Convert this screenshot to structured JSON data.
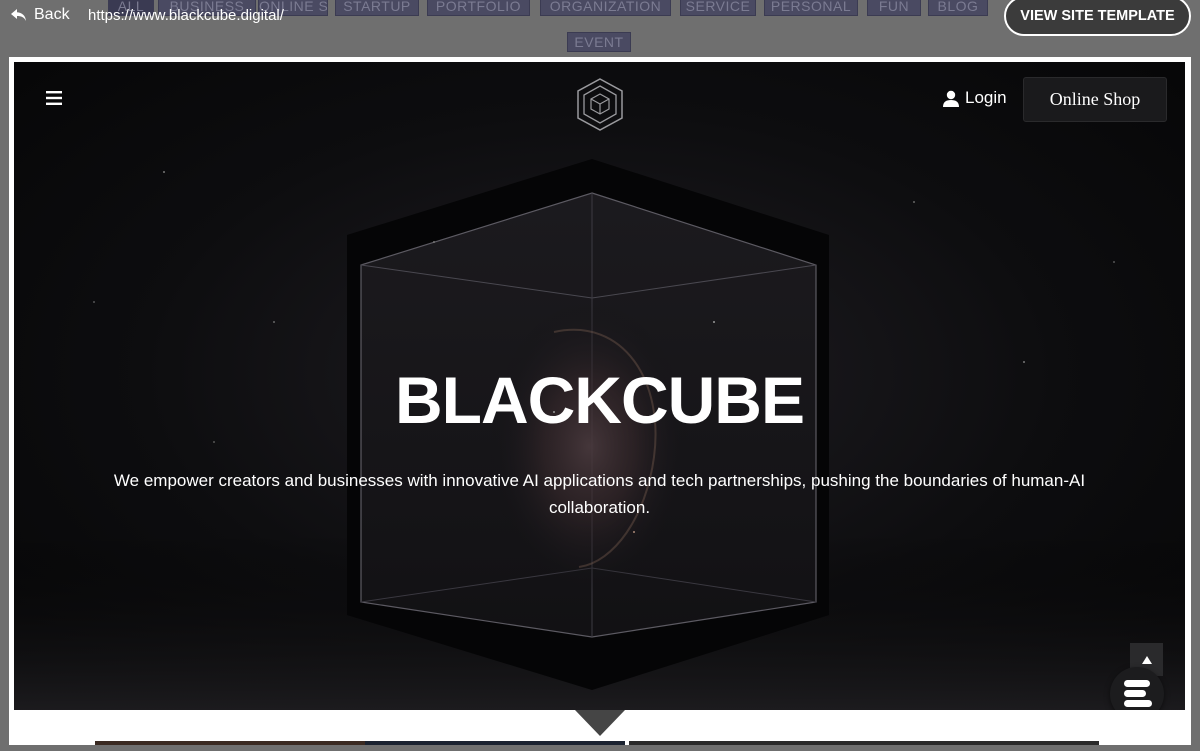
{
  "top_bar": {
    "back_label": "Back",
    "url": "https://www.blackcube.digital/",
    "view_button_label": "VIEW SITE TEMPLATE",
    "filters": [
      "ALL",
      "BUSINESS",
      "ONLINE STORE",
      "STARTUP",
      "PORTFOLIO",
      "ORGANIZATION",
      "SERVICE",
      "PERSONAL",
      "FUN",
      "BLOG",
      "EVENT"
    ]
  },
  "site": {
    "login_label": "Login",
    "shop_label": "Online Shop",
    "hero_title": "BLACKCUBE",
    "hero_subtitle": "We empower creators and businesses with innovative AI applications and tech partnerships, pushing the boundaries of human-AI collaboration."
  },
  "icons": {
    "back": "undo-arrow-icon",
    "menu": "hamburger-menu-icon",
    "logo": "cube-logo-icon",
    "user": "user-icon",
    "scroll_top": "arrow-up-icon",
    "chat": "chat-widget-icon"
  },
  "colors": {
    "overlay_bg": "#6f6f6f",
    "chip_bg": "#4a4a62",
    "chip_text": "#7b7b92",
    "hero_bg": "#0d0d0f",
    "text": "#ffffff"
  }
}
